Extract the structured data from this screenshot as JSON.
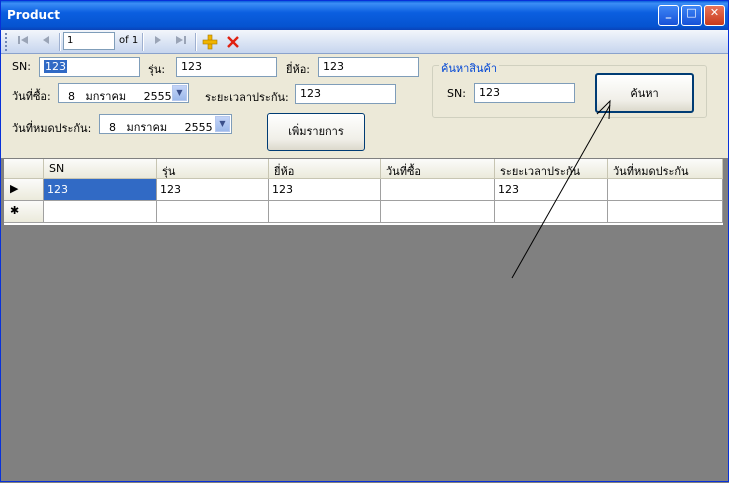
{
  "window": {
    "title": "Product"
  },
  "titlebar_buttons": {
    "minimize": "_",
    "maximize": "□",
    "close": "✕"
  },
  "navigator": {
    "position": "1",
    "count_label": "of 1",
    "icons": [
      "first-icon",
      "prev-icon",
      "next-icon",
      "last-icon",
      "add-icon",
      "delete-icon"
    ]
  },
  "form": {
    "sn_label": "SN:",
    "sn_value": "123",
    "model_label": "รุ่น:",
    "model_value": "123",
    "brand_label": "ยี่ห้อ:",
    "brand_value": "123",
    "purchase_date_label": "วันที่ซื้อ:",
    "purchase_date_value": "8   มกราคม     2555",
    "warranty_period_label": "ระยะเวลาประกัน:",
    "warranty_period_value": "123",
    "warranty_expiry_label": "วันที่หมดประกัน:",
    "warranty_expiry_value": "8   มกราคม     2555",
    "add_button": "เพิ่มรายการ"
  },
  "search_group": {
    "title": "ค้นหาสินค้า",
    "sn_label": "SN:",
    "sn_value": "123",
    "search_button": "ค้นหา"
  },
  "grid": {
    "columns": [
      "SN",
      "รุ่น",
      "ยี่ห้อ",
      "วันที่ซื้อ",
      "ระยะเวลาประกัน",
      "วันที่หมดประกัน"
    ],
    "rows": [
      {
        "marker": "▶",
        "cells": [
          "123",
          "123",
          "123",
          "",
          "123",
          ""
        ]
      },
      {
        "marker": "✱",
        "cells": [
          "",
          "",
          "",
          "",
          "",
          ""
        ]
      }
    ]
  },
  "colors": {
    "accent": "#316ac5",
    "titlebar": "#0553d0",
    "client_bg": "#808080",
    "form_bg": "#ece9d8"
  }
}
